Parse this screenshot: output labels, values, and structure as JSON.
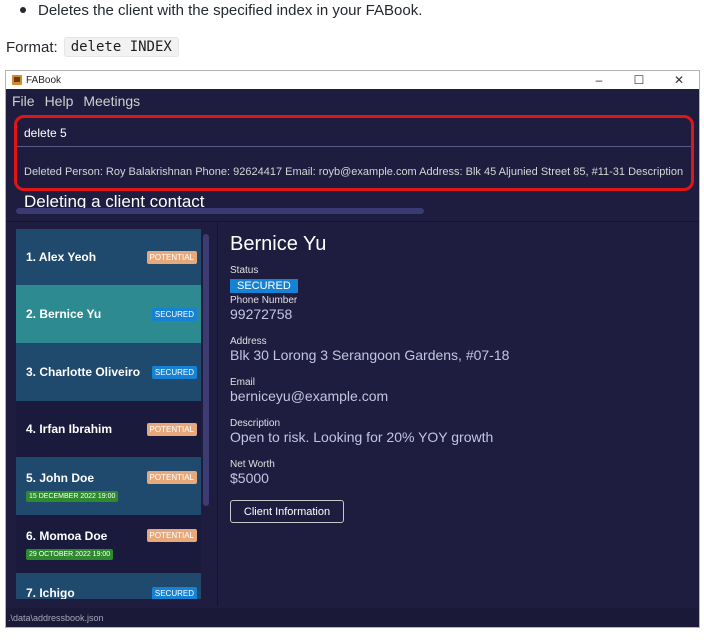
{
  "doc": {
    "bullet_text": "Deletes the client with the specified index in your FABook.",
    "format_label": "Format:",
    "format_code": "delete INDEX"
  },
  "window": {
    "title": "FABook",
    "minimize": "–",
    "maximize": "☐",
    "close": "✕"
  },
  "menu": [
    "File",
    "Help",
    "Meetings"
  ],
  "command": {
    "input_value": "delete 5",
    "result": "Deleted Person: Roy Balakrishnan Phone: 92624417 Email: royb@example.com Address: Blk 45 Aljunied Street 85, #11-31 Description"
  },
  "caption": "Deleting a client contact",
  "clients": [
    {
      "index_name": "1. Alex Yeoh",
      "status": "POTENTIAL",
      "meeting": null
    },
    {
      "index_name": "2. Bernice Yu",
      "status": "SECURED",
      "meeting": null
    },
    {
      "index_name": "3. Charlotte Oliveiro",
      "status": "SECURED",
      "meeting": null
    },
    {
      "index_name": "4. Irfan Ibrahim",
      "status": "POTENTIAL",
      "meeting": null
    },
    {
      "index_name": "5. John Doe",
      "status": "POTENTIAL",
      "meeting": "15 DECEMBER 2022 19:00"
    },
    {
      "index_name": "6. Momoa Doe",
      "status": "POTENTIAL",
      "meeting": "29 OCTOBER 2022 19:00"
    },
    {
      "index_name": "7. Ichigo",
      "status": "SECURED",
      "meeting": null
    }
  ],
  "selected_index": 1,
  "detail": {
    "name": "Bernice Yu",
    "status_label": "Status",
    "status": "SECURED",
    "phone_label": "Phone Number",
    "phone": "99272758",
    "address_label": "Address",
    "address": "Blk 30 Lorong 3 Serangoon Gardens, #07-18",
    "email_label": "Email",
    "email": "berniceyu@example.com",
    "description_label": "Description",
    "description": "Open to risk. Looking for 20% YOY growth",
    "networth_label": "Net Worth",
    "networth": "$5000",
    "client_info_button": "Client Information"
  },
  "status_bar": ".\\data\\addressbook.json",
  "colors": {
    "window_bg": "#1e1d3f",
    "card_dark": "#1a1a3c",
    "card_alt": "#1f4a6e",
    "card_selected": "#2e8a91",
    "secured": "#1682d4",
    "potential": "#e7a87c",
    "meeting": "#2f8a2f",
    "highlight": "#e01515"
  }
}
